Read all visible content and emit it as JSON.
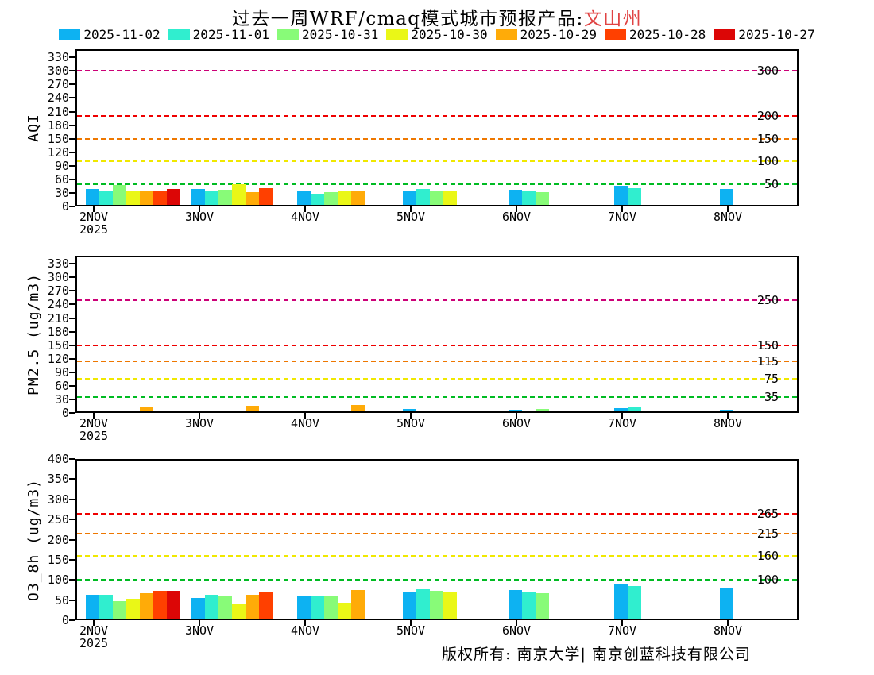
{
  "title": {
    "main": "过去一周WRF/cmaq模式城市预报产品:",
    "region": "文山州",
    "region_color": "#E04343"
  },
  "caption": "版权所有: 南京大学| 南京创蓝科技有限公司",
  "chart_data": [
    {
      "type": "bar",
      "ylabel": "AQI",
      "ylim": [
        0,
        348
      ],
      "yticks": [
        0,
        30,
        60,
        90,
        120,
        150,
        180,
        210,
        240,
        270,
        300,
        330
      ],
      "categories": [
        "2NOV",
        "3NOV",
        "4NOV",
        "5NOV",
        "6NOV",
        "7NOV",
        "8NOV"
      ],
      "x_year_label": "2025",
      "grid": "off",
      "legend_position": "top",
      "thresholds": [
        {
          "value": 50,
          "color": "#00BB22",
          "label": "50"
        },
        {
          "value": 100,
          "color": "#F0E800",
          "label": "100"
        },
        {
          "value": 150,
          "color": "#EE7700",
          "label": "150"
        },
        {
          "value": 200,
          "color": "#EE0000",
          "label": "200"
        },
        {
          "value": 300,
          "color": "#CC0077",
          "label": "300"
        }
      ],
      "series": [
        {
          "name": "2025-11-02",
          "color": "#0DB2F2",
          "values": [
            38,
            39,
            34,
            36,
            37,
            45,
            38
          ]
        },
        {
          "name": "2025-11-01",
          "color": "#30EECF",
          "values": [
            36,
            34,
            29,
            39,
            35,
            41
          ]
        },
        {
          "name": "2025-10-31",
          "color": "#88FB78",
          "values": [
            48,
            37,
            31,
            34,
            32
          ]
        },
        {
          "name": "2025-10-30",
          "color": "#EAF717",
          "values": [
            35,
            49,
            35,
            36
          ]
        },
        {
          "name": "2025-10-29",
          "color": "#FFAB08",
          "values": [
            34,
            32,
            36
          ]
        },
        {
          "name": "2025-10-28",
          "color": "#FF4000",
          "values": [
            36,
            41
          ]
        },
        {
          "name": "2025-10-27",
          "color": "#DC0606",
          "values": [
            38
          ]
        }
      ]
    },
    {
      "type": "bar",
      "ylabel": "PM2.5 (ug/m3)",
      "ylim": [
        0,
        348
      ],
      "yticks": [
        0,
        30,
        60,
        90,
        120,
        150,
        180,
        210,
        240,
        270,
        300,
        330
      ],
      "categories": [
        "2NOV",
        "3NOV",
        "4NOV",
        "5NOV",
        "6NOV",
        "7NOV",
        "8NOV"
      ],
      "x_year_label": "2025",
      "grid": "off",
      "thresholds": [
        {
          "value": 35,
          "color": "#00BB22",
          "label": "35"
        },
        {
          "value": 75,
          "color": "#F0E800",
          "label": "75"
        },
        {
          "value": 115,
          "color": "#EE7700",
          "label": "115"
        },
        {
          "value": 150,
          "color": "#EE0000",
          "label": "150"
        },
        {
          "value": 250,
          "color": "#CC0077",
          "label": "250"
        }
      ],
      "series": [
        {
          "name": "2025-11-02",
          "color": "#0DB2F2",
          "values": [
            6,
            4,
            3,
            9,
            7,
            10,
            7
          ]
        },
        {
          "name": "2025-11-01",
          "color": "#30EECF",
          "values": [
            1,
            1,
            3,
            4,
            6,
            12
          ]
        },
        {
          "name": "2025-10-31",
          "color": "#88FB78",
          "values": [
            4,
            3,
            5,
            5,
            9
          ]
        },
        {
          "name": "2025-10-30",
          "color": "#EAF717",
          "values": [
            4,
            4,
            3,
            6
          ]
        },
        {
          "name": "2025-10-29",
          "color": "#FFAB08",
          "values": [
            14,
            16,
            17
          ]
        },
        {
          "name": "2025-10-28",
          "color": "#FF4000",
          "values": [
            2,
            5
          ]
        },
        {
          "name": "2025-10-27",
          "color": "#DC0606",
          "values": [
            4
          ]
        }
      ]
    },
    {
      "type": "bar",
      "ylabel": "O3_8h (ug/m3)",
      "ylim": [
        0,
        400
      ],
      "yticks": [
        0,
        50,
        100,
        150,
        200,
        250,
        300,
        350,
        400
      ],
      "categories": [
        "2NOV",
        "3NOV",
        "4NOV",
        "5NOV",
        "6NOV",
        "7NOV",
        "8NOV"
      ],
      "x_year_label": "2025",
      "grid": "off",
      "thresholds": [
        {
          "value": 100,
          "color": "#00BB22",
          "label": "100"
        },
        {
          "value": 160,
          "color": "#F0E800",
          "label": "160"
        },
        {
          "value": 215,
          "color": "#EE7700",
          "label": "215"
        },
        {
          "value": 265,
          "color": "#EE0000",
          "label": "265"
        }
      ],
      "series": [
        {
          "name": "2025-11-02",
          "color": "#0DB2F2",
          "values": [
            64,
            56,
            59,
            71,
            74,
            89,
            78
          ]
        },
        {
          "name": "2025-11-01",
          "color": "#30EECF",
          "values": [
            64,
            63,
            59,
            76,
            70,
            84
          ]
        },
        {
          "name": "2025-10-31",
          "color": "#88FB78",
          "values": [
            48,
            59,
            60,
            72,
            67
          ]
        },
        {
          "name": "2025-10-30",
          "color": "#EAF717",
          "values": [
            53,
            41,
            43,
            68
          ]
        },
        {
          "name": "2025-10-29",
          "color": "#FFAB08",
          "values": [
            67,
            64,
            75
          ]
        },
        {
          "name": "2025-10-28",
          "color": "#FF4000",
          "values": [
            72,
            70
          ]
        },
        {
          "name": "2025-10-27",
          "color": "#DC0606",
          "values": [
            72
          ]
        }
      ]
    }
  ]
}
